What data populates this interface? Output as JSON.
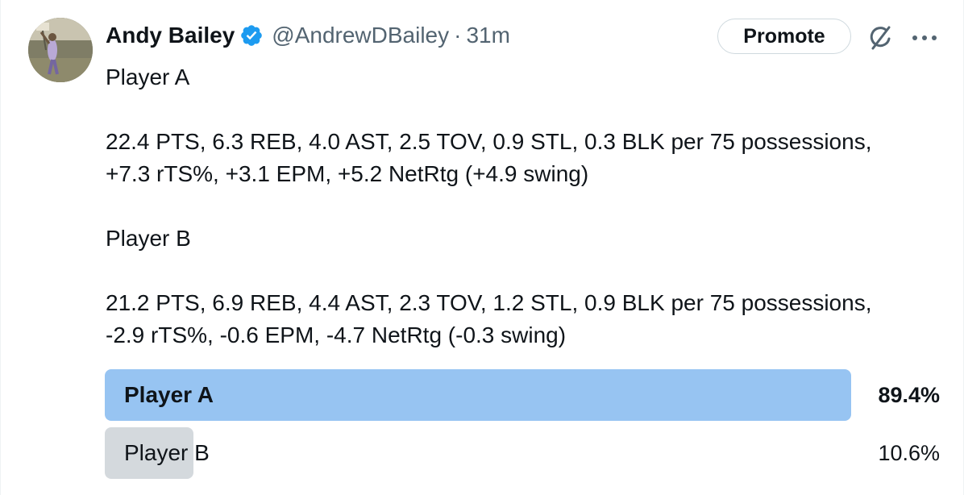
{
  "author": {
    "display_name": "Andy Bailey",
    "handle": "@AndrewDBailey",
    "separator": "·",
    "time_ago": "31m",
    "verified_color": "#1d9bf0"
  },
  "actions": {
    "promote_label": "Promote",
    "grok_icon": "grok-icon",
    "more_icon": "more-icon"
  },
  "tweet": {
    "line1": "Player A",
    "line2a": "22.4 PTS, 6.3 REB, 4.0 AST, 2.5 TOV, 0.9 STL, 0.3 BLK per 75 possessions,",
    "line2b": "+7.3 rTS%, +3.1 EPM, +5.2 NetRtg (+4.9 swing)",
    "line3": "Player B",
    "line4a": "21.2 PTS, 6.9 REB, 4.4 AST, 2.3 TOV, 1.2 STL, 0.9 BLK per 75 possessions,",
    "line4b": "-2.9 rTS%, -0.6 EPM, -4.7 NetRtg (-0.3 swing)"
  },
  "poll": {
    "options": [
      {
        "label": "Player A",
        "percent_text": "89.4%",
        "percent": 89.4,
        "winner": true,
        "color": "#97c4f2"
      },
      {
        "label": "Player B",
        "percent_text": "10.6%",
        "percent": 10.6,
        "winner": false,
        "color": "#d4d9dd"
      }
    ]
  }
}
